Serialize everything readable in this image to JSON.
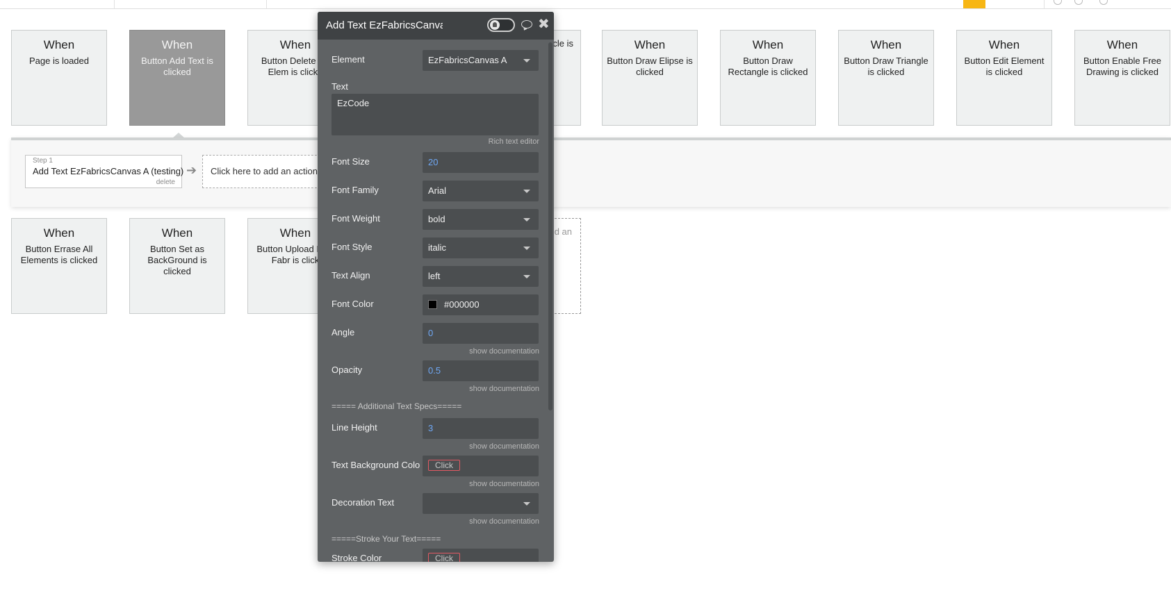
{
  "events_row1": [
    {
      "when": "When",
      "desc": "Page is loaded"
    },
    {
      "when": "When",
      "desc": "Button Add Text is clicked",
      "selected": true
    },
    {
      "when": "When",
      "desc": "Button Delete Se Elem is clicke"
    },
    {
      "when": "",
      "desc": "cle is"
    },
    {
      "when": "When",
      "desc": "Button Draw Elipse is clicked"
    },
    {
      "when": "When",
      "desc": "Button Draw Rectangle is clicked"
    },
    {
      "when": "When",
      "desc": "Button Draw Triangle is clicked"
    },
    {
      "when": "When",
      "desc": "Button Edit Element is clicked"
    },
    {
      "when": "When",
      "desc": "Button Enable Free Drawing is clicked"
    }
  ],
  "events_row2": [
    {
      "when": "When",
      "desc": "Button Errase All Elements is clicked"
    },
    {
      "when": "When",
      "desc": "Button Set as BackGround is clicked"
    },
    {
      "when": "When",
      "desc": "Button Upload In to Fabr is click"
    },
    {
      "when": "",
      "desc": "d an"
    }
  ],
  "workflow": {
    "step_number": "Step 1",
    "step_name": "Add Text EzFabricsCanvas A (testing)",
    "step_delete": "delete",
    "add_action": "Click here to add an action..."
  },
  "panel": {
    "title": "Add Text EzFabricsCanvas A",
    "element": {
      "label": "Element",
      "value": "EzFabricsCanvas A"
    },
    "text": {
      "label": "Text",
      "value": "EzCode",
      "hint": "Rich text editor"
    },
    "font_size": {
      "label": "Font Size",
      "value": "20"
    },
    "font_family": {
      "label": "Font Family",
      "value": "Arial"
    },
    "font_weight": {
      "label": "Font Weight",
      "value": "bold"
    },
    "font_style": {
      "label": "Font Style",
      "value": "italic"
    },
    "text_align": {
      "label": "Text Align",
      "value": "left"
    },
    "font_color": {
      "label": "Font Color",
      "value": "#000000"
    },
    "angle": {
      "label": "Angle",
      "value": "0",
      "hint": "show documentation"
    },
    "opacity": {
      "label": "Opacity",
      "value": "0.5",
      "hint": "show documentation"
    },
    "section_additional": "===== Additional Text Specs=====",
    "line_height": {
      "label": "Line Height",
      "value": "3",
      "hint": "show documentation"
    },
    "text_bg_color": {
      "label": "Text Background Colo",
      "value": "Click",
      "hint": "show documentation"
    },
    "decoration_text": {
      "label": "Decoration Text",
      "value": "",
      "hint": "show documentation"
    },
    "section_stroke": "=====Stroke Your Text=====",
    "stroke_color": {
      "label": "Stroke Color",
      "value": "Click"
    }
  },
  "colors": {
    "accent": "#f7b614",
    "panel_bg": "#5f6264",
    "panel_header": "#3f4244",
    "numeric_value": "#6fa8f5",
    "click_pill_border": "#e35a64"
  }
}
